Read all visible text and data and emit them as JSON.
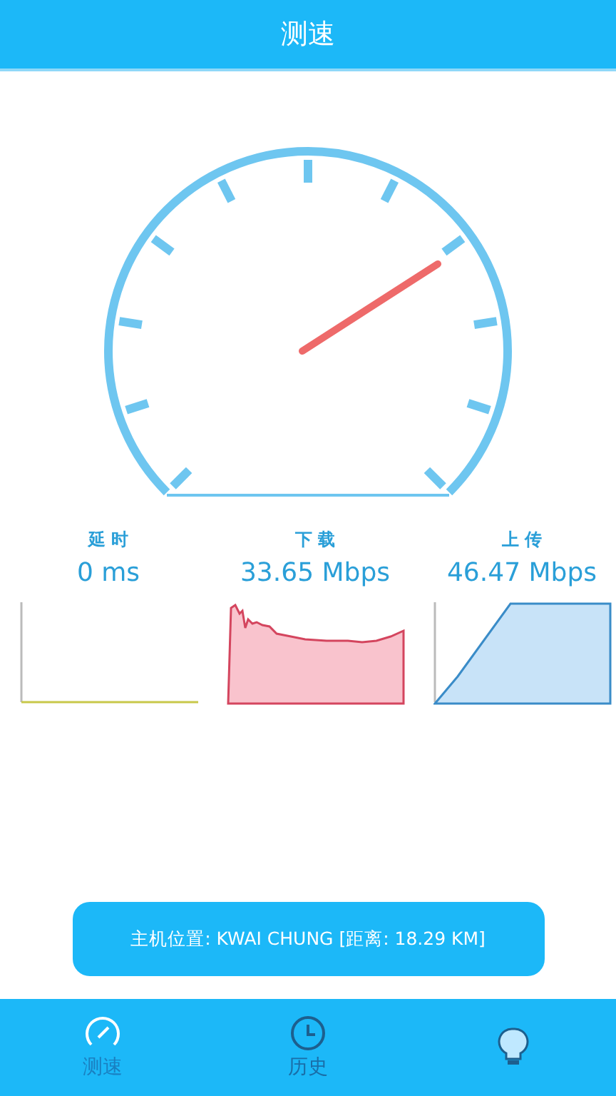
{
  "header": {
    "title": "测速"
  },
  "stats": [
    {
      "kind": "latency",
      "label": "延 时",
      "value": "0 ms"
    },
    {
      "kind": "download",
      "label": "下 载",
      "value": "33.65 Mbps"
    },
    {
      "kind": "upload",
      "label": "上 传",
      "value": "46.47 Mbps"
    }
  ],
  "server": {
    "text": "主机位置: KWAI CHUNG [距离: 18.29 KM]"
  },
  "tabs": [
    {
      "kind": "gauge",
      "label": "测速",
      "selected": true
    },
    {
      "kind": "clock",
      "label": "历史",
      "selected": false
    },
    {
      "kind": "bulb",
      "selected": false
    }
  ]
}
